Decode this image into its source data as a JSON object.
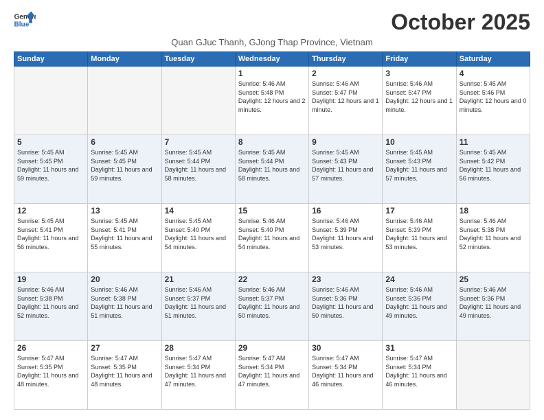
{
  "header": {
    "logo_line1": "General",
    "logo_line2": "Blue",
    "month_year": "October 2025",
    "subtitle": "Quan GJuc Thanh, GJong Thap Province, Vietnam"
  },
  "days_of_week": [
    "Sunday",
    "Monday",
    "Tuesday",
    "Wednesday",
    "Thursday",
    "Friday",
    "Saturday"
  ],
  "weeks": [
    [
      {
        "day": "",
        "text": ""
      },
      {
        "day": "",
        "text": ""
      },
      {
        "day": "",
        "text": ""
      },
      {
        "day": "1",
        "text": "Sunrise: 5:46 AM\nSunset: 5:48 PM\nDaylight: 12 hours and 2 minutes."
      },
      {
        "day": "2",
        "text": "Sunrise: 5:46 AM\nSunset: 5:47 PM\nDaylight: 12 hours and 1 minute."
      },
      {
        "day": "3",
        "text": "Sunrise: 5:46 AM\nSunset: 5:47 PM\nDaylight: 12 hours and 1 minute."
      },
      {
        "day": "4",
        "text": "Sunrise: 5:45 AM\nSunset: 5:46 PM\nDaylight: 12 hours and 0 minutes."
      }
    ],
    [
      {
        "day": "5",
        "text": "Sunrise: 5:45 AM\nSunset: 5:45 PM\nDaylight: 11 hours and 59 minutes."
      },
      {
        "day": "6",
        "text": "Sunrise: 5:45 AM\nSunset: 5:45 PM\nDaylight: 11 hours and 59 minutes."
      },
      {
        "day": "7",
        "text": "Sunrise: 5:45 AM\nSunset: 5:44 PM\nDaylight: 11 hours and 58 minutes."
      },
      {
        "day": "8",
        "text": "Sunrise: 5:45 AM\nSunset: 5:44 PM\nDaylight: 11 hours and 58 minutes."
      },
      {
        "day": "9",
        "text": "Sunrise: 5:45 AM\nSunset: 5:43 PM\nDaylight: 11 hours and 57 minutes."
      },
      {
        "day": "10",
        "text": "Sunrise: 5:45 AM\nSunset: 5:43 PM\nDaylight: 11 hours and 57 minutes."
      },
      {
        "day": "11",
        "text": "Sunrise: 5:45 AM\nSunset: 5:42 PM\nDaylight: 11 hours and 56 minutes."
      }
    ],
    [
      {
        "day": "12",
        "text": "Sunrise: 5:45 AM\nSunset: 5:41 PM\nDaylight: 11 hours and 56 minutes."
      },
      {
        "day": "13",
        "text": "Sunrise: 5:45 AM\nSunset: 5:41 PM\nDaylight: 11 hours and 55 minutes."
      },
      {
        "day": "14",
        "text": "Sunrise: 5:45 AM\nSunset: 5:40 PM\nDaylight: 11 hours and 54 minutes."
      },
      {
        "day": "15",
        "text": "Sunrise: 5:46 AM\nSunset: 5:40 PM\nDaylight: 11 hours and 54 minutes."
      },
      {
        "day": "16",
        "text": "Sunrise: 5:46 AM\nSunset: 5:39 PM\nDaylight: 11 hours and 53 minutes."
      },
      {
        "day": "17",
        "text": "Sunrise: 5:46 AM\nSunset: 5:39 PM\nDaylight: 11 hours and 53 minutes."
      },
      {
        "day": "18",
        "text": "Sunrise: 5:46 AM\nSunset: 5:38 PM\nDaylight: 11 hours and 52 minutes."
      }
    ],
    [
      {
        "day": "19",
        "text": "Sunrise: 5:46 AM\nSunset: 5:38 PM\nDaylight: 11 hours and 52 minutes."
      },
      {
        "day": "20",
        "text": "Sunrise: 5:46 AM\nSunset: 5:38 PM\nDaylight: 11 hours and 51 minutes."
      },
      {
        "day": "21",
        "text": "Sunrise: 5:46 AM\nSunset: 5:37 PM\nDaylight: 11 hours and 51 minutes."
      },
      {
        "day": "22",
        "text": "Sunrise: 5:46 AM\nSunset: 5:37 PM\nDaylight: 11 hours and 50 minutes."
      },
      {
        "day": "23",
        "text": "Sunrise: 5:46 AM\nSunset: 5:36 PM\nDaylight: 11 hours and 50 minutes."
      },
      {
        "day": "24",
        "text": "Sunrise: 5:46 AM\nSunset: 5:36 PM\nDaylight: 11 hours and 49 minutes."
      },
      {
        "day": "25",
        "text": "Sunrise: 5:46 AM\nSunset: 5:36 PM\nDaylight: 11 hours and 49 minutes."
      }
    ],
    [
      {
        "day": "26",
        "text": "Sunrise: 5:47 AM\nSunset: 5:35 PM\nDaylight: 11 hours and 48 minutes."
      },
      {
        "day": "27",
        "text": "Sunrise: 5:47 AM\nSunset: 5:35 PM\nDaylight: 11 hours and 48 minutes."
      },
      {
        "day": "28",
        "text": "Sunrise: 5:47 AM\nSunset: 5:34 PM\nDaylight: 11 hours and 47 minutes."
      },
      {
        "day": "29",
        "text": "Sunrise: 5:47 AM\nSunset: 5:34 PM\nDaylight: 11 hours and 47 minutes."
      },
      {
        "day": "30",
        "text": "Sunrise: 5:47 AM\nSunset: 5:34 PM\nDaylight: 11 hours and 46 minutes."
      },
      {
        "day": "31",
        "text": "Sunrise: 5:47 AM\nSunset: 5:34 PM\nDaylight: 11 hours and 46 minutes."
      },
      {
        "day": "",
        "text": ""
      }
    ]
  ]
}
